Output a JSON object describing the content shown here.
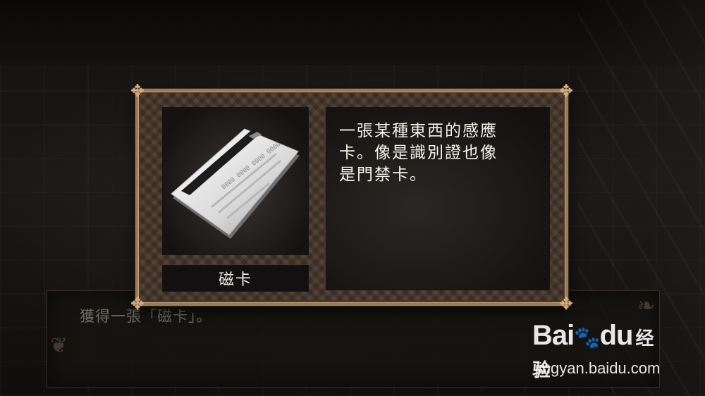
{
  "message": {
    "text": "獲得一張「磁卡」。"
  },
  "item": {
    "name": "磁卡",
    "image_icon": "magnetic-card-icon",
    "card_text": "0000 0000 0000 0000",
    "description_lines": [
      "一張某種東西的感應",
      "卡。像是識別證也像",
      "是門禁卡。"
    ]
  },
  "watermark": {
    "logo_text": "Bai",
    "logo_text_tail": "du",
    "logo_suffix": "经验",
    "url": "jingyan.baidu.com"
  },
  "colors": {
    "frame_gold": "#9b7a58",
    "panel_bg": "#4a3a2e",
    "text_white": "#f5f2ec",
    "message_text": "#6f6a64"
  }
}
